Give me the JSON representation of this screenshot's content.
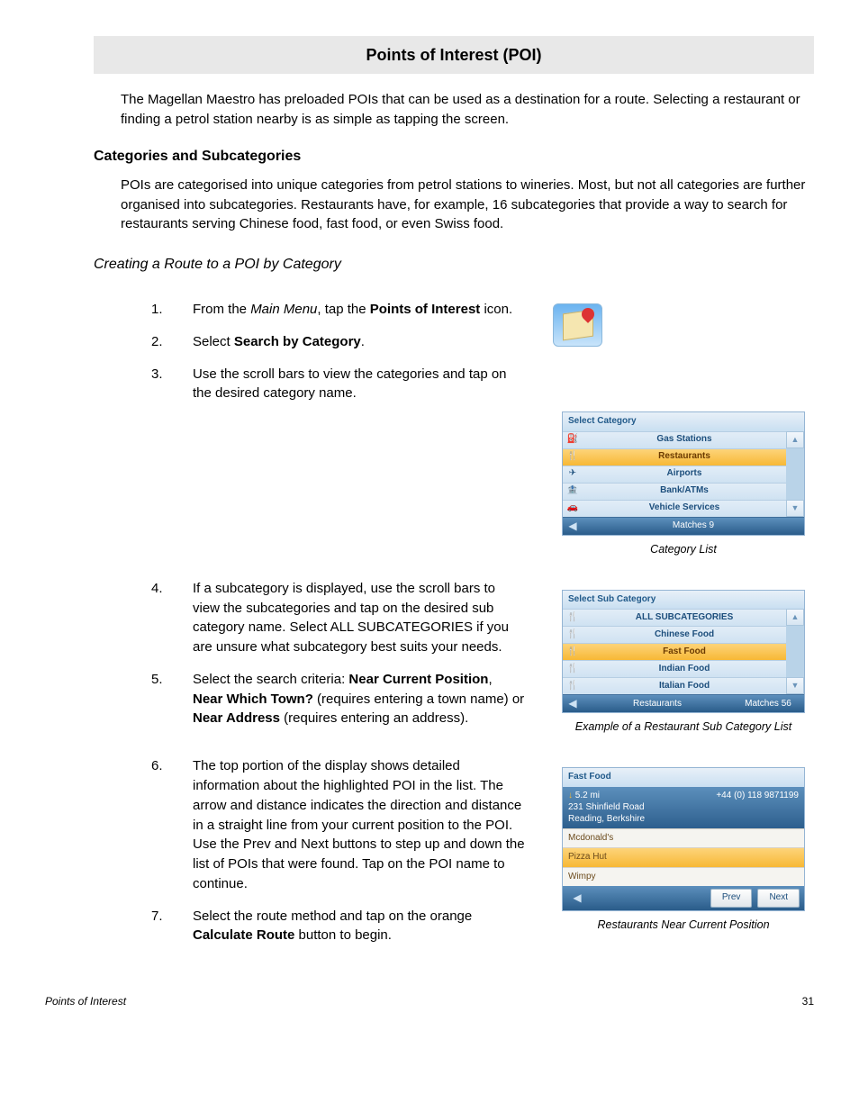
{
  "page": {
    "title": "Points of Interest (POI)",
    "intro": "The Magellan Maestro has preloaded POIs that can be used as a destination for a route. Selecting a restaurant or finding a petrol station nearby is as simple as tapping the screen.",
    "section_heading": "Categories and Subcategories",
    "section_text": "POIs are categorised into unique categories from petrol stations to wineries. Most, but not all categories are further organised into subcategories. Restaurants have, for example, 16 subcategories that provide a way to search for restaurants serving Chinese food, fast food, or even Swiss food.",
    "subsection_heading": "Creating a Route to a POI by Category",
    "footer_left": "Points of Interest",
    "footer_right": "31"
  },
  "steps": {
    "s1_pre": "From the ",
    "s1_em": "Main Menu",
    "s1_mid": ", tap the ",
    "s1_b": "Points of Interest",
    "s1_post": " icon.",
    "s2_pre": "Select ",
    "s2_b": "Search by Category",
    "s2_post": ".",
    "s3": "Use the scroll bars to view the categories and tap on the desired category name.",
    "s4": "If a subcategory is displayed, use the scroll bars to view the subcategories and tap on the desired sub category name. Select ALL SUBCATEGORIES if you are unsure what subcategory best suits your needs.",
    "s5_pre": "Select the search criteria: ",
    "s5_b1": "Near Current Position",
    "s5_sep1": ", ",
    "s5_b2": "Near Which Town?",
    "s5_mid": " (requires entering a town name) or ",
    "s5_b3": "Near Address",
    "s5_post": " (requires entering an address).",
    "s6a": "The top portion of the display shows detailed information about the highlighted POI in the list. The arrow and distance indicates the direction and distance in a straight line from your current position to the POI.",
    "s6b": "Use the Prev and Next buttons to step up and down the list of POIs that were found. Tap on the POI name to continue.",
    "s7_pre": "Select the route method and tap on the orange ",
    "s7_b": "Calculate Route",
    "s7_post": " button to begin."
  },
  "screen1": {
    "header": "Select Category",
    "rows": [
      {
        "icon": "⛽",
        "label": "Gas Stations",
        "sel": false
      },
      {
        "icon": "🍴",
        "label": "Restaurants",
        "sel": true
      },
      {
        "icon": "✈",
        "label": "Airports",
        "sel": false
      },
      {
        "icon": "🏦",
        "label": "Bank/ATMs",
        "sel": false
      },
      {
        "icon": "🚗",
        "label": "Vehicle Services",
        "sel": false
      }
    ],
    "footer_center": "Matches  9",
    "caption": "Category List"
  },
  "screen2": {
    "header": "Select Sub Category",
    "rows": [
      {
        "icon": "🍴",
        "label": "ALL SUBCATEGORIES",
        "sel": false
      },
      {
        "icon": "🍴",
        "label": "Chinese Food",
        "sel": false
      },
      {
        "icon": "🍴",
        "label": "Fast Food",
        "sel": true
      },
      {
        "icon": "🍴",
        "label": "Indian Food",
        "sel": false
      },
      {
        "icon": "🍴",
        "label": "Italian Food",
        "sel": false
      }
    ],
    "footer_left": "Restaurants",
    "footer_right": "Matches  56",
    "caption": "Example of a Restaurant Sub Category List"
  },
  "screen3": {
    "header": "Fast Food",
    "distance": "5.2 mi",
    "phone": "+44 (0) 118 9871199",
    "addr1": "231 Shinfield Road",
    "addr2": "Reading, Berkshire",
    "rows": [
      {
        "label": "Mcdonald's",
        "sel": false
      },
      {
        "label": "Pizza Hut",
        "sel": true
      },
      {
        "label": "Wimpy",
        "sel": false
      }
    ],
    "prev": "Prev",
    "next": "Next",
    "caption": "Restaurants Near Current Position"
  }
}
